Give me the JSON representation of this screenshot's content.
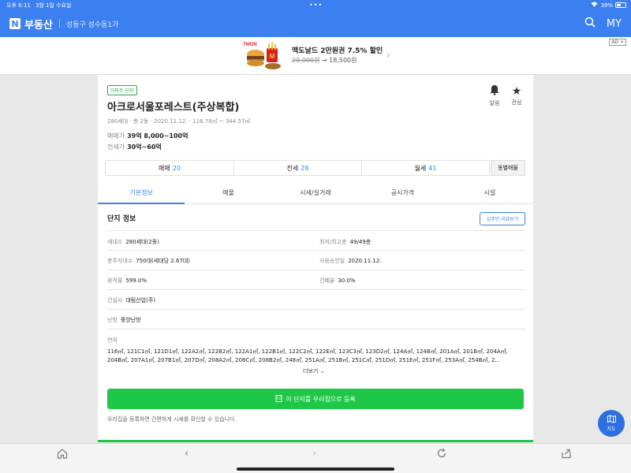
{
  "status": {
    "time": "오후 6:11",
    "date": "3월 1일 수요일",
    "battery": "39%",
    "battery_level": 0.39
  },
  "nav": {
    "logo": "N",
    "brand": "부동산",
    "location": "성동구 성수동1가",
    "my": "MY"
  },
  "ad": {
    "title": "맥도날드 2만원권 7.5% 할인",
    "old_price": "20,000원",
    "arrow": "→",
    "new_price": "18,500원",
    "badge": "AD ×",
    "logo_text": "TMON"
  },
  "complex": {
    "tag": "아파트·단지",
    "title": "아크로서울포레스트(주상복합)",
    "meta": "280세대 · 총 2동 · 2020.11.12. · 116.78㎡ ~ 344.57㎡",
    "sale_label": "매매가",
    "sale_value": "39억 8,000~100억",
    "jeonse_label": "전세가",
    "jeonse_value": "30억~60억",
    "alarm_label": "알림",
    "fav_label": "관심"
  },
  "trades": [
    {
      "label": "매매",
      "count": "20"
    },
    {
      "label": "전세",
      "count": "28"
    },
    {
      "label": "월세",
      "count": "41"
    }
  ],
  "same_btn": "동별매물",
  "tabs": [
    "기본정보",
    "매물",
    "시세/실거래",
    "공시가격",
    "시설"
  ],
  "section": {
    "title": "단지 정보",
    "review_btn": "입주민 리뷰보기"
  },
  "info": {
    "households_k": "세대수",
    "households_v": "280세대(2동)",
    "floors_k": "최저/최고층",
    "floors_v": "49/49층",
    "parking_k": "총주차대수",
    "parking_v": "750대(세대당 2.67대)",
    "approval_k": "사용승인일",
    "approval_v": "2020.11.12.",
    "far_k": "용적률",
    "far_v": "599.0%",
    "bcr_k": "건폐율",
    "bcr_v": "30.0%",
    "builder_k": "건설사",
    "builder_v": "대림산업(주)",
    "heating_k": "난방",
    "heating_v": "중앙난방",
    "area_k": "면적",
    "area_line1": "116㎡, 121C1㎡, 121D1㎡, 122A2㎡, 122B2㎡, 122A1㎡, 122B1㎡, 122C2㎡, 122E㎡, 123C3㎡, 123D2㎡, 124A㎡, 124B㎡, 201A㎡, 201B㎡, 204A㎡,",
    "area_line2": "204B㎡, 207A1㎡, 207B1㎡, 207D㎡, 208A2㎡, 208C㎡, 208B2㎡, 248㎡, 251A㎡, 251B㎡, 251C㎡, 251D㎡, 251E㎡, 251F㎡, 253A㎡, 254B㎡, 2...",
    "more": "더보기"
  },
  "register": {
    "button": "이 단지를 우리집으로 등록",
    "note": "우리집을 등록하면 간편하게 시세를 확인할 수 있습니다."
  },
  "map_btn": "지도",
  "icons": {
    "search": "search-icon",
    "bell": "bell-icon",
    "star": "star-icon",
    "home": "home-icon",
    "back": "chevron-left-icon",
    "forward": "chevron-right-icon",
    "refresh": "refresh-icon",
    "share": "share-icon",
    "map": "map-icon"
  },
  "colors": {
    "primary": "#3b7ff0",
    "green": "#1ec748"
  }
}
